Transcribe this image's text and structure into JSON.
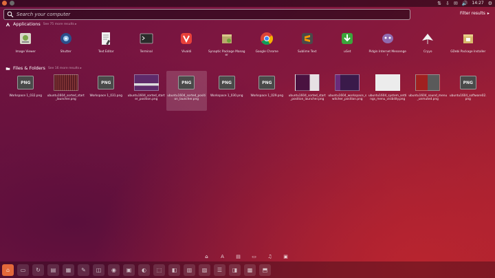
{
  "top_panel": {
    "indicators": [
      "⇅",
      "⇩",
      "✉",
      "🔊",
      "⚙"
    ],
    "time": "14:27"
  },
  "search": {
    "placeholder": "Search your computer"
  },
  "filter": {
    "label": "Filter results",
    "arrow": "▸"
  },
  "applications": {
    "title": "Applications",
    "see_more": "See 75 more results ▸",
    "items": [
      {
        "label": "Image Viewer",
        "icon": "image-viewer-icon"
      },
      {
        "label": "Shutter",
        "icon": "shutter-icon"
      },
      {
        "label": "Text Editor",
        "icon": "text-editor-icon"
      },
      {
        "label": "Terminal",
        "icon": "terminal-icon"
      },
      {
        "label": "Vivaldi",
        "icon": "vivaldi-icon"
      },
      {
        "label": "Synaptic Package Manager",
        "icon": "synaptic-icon"
      },
      {
        "label": "Google Chrome",
        "icon": "chrome-icon"
      },
      {
        "label": "Sublime Text",
        "icon": "sublime-icon"
      },
      {
        "label": "uGet",
        "icon": "uget-icon"
      },
      {
        "label": "Pidgin Internet Messenger",
        "icon": "pidgin-icon"
      },
      {
        "label": "Cryyo",
        "icon": "cryyo-icon"
      },
      {
        "label": "GDebi Package Installer",
        "icon": "gdebi-icon"
      }
    ]
  },
  "files": {
    "title": "Files & Folders",
    "see_more": "See 16 more results ▸",
    "items": [
      {
        "label": "Workspace 1_032.png",
        "thumb": "png"
      },
      {
        "label": "ubuntu1604_sorted_start_launcher.png",
        "thumb": "shot-keyboard"
      },
      {
        "label": "Workspace 1_031.png",
        "thumb": "png"
      },
      {
        "label": "ubuntu1604_sorted_starter_position.png",
        "thumb": "shot-purple"
      },
      {
        "label": "ubuntu1604_sorted_position_launcher.png",
        "thumb": "png",
        "highlight": true
      },
      {
        "label": "Workspace 1_030.png",
        "thumb": "png"
      },
      {
        "label": "Workspace 1_029.png",
        "thumb": "png"
      },
      {
        "label": "ubuntu1604_sorted_start_position_launcher.png",
        "thumb": "shot-dark"
      },
      {
        "label": "ubuntu1604_workspace_switcher_position.png",
        "thumb": "shot-violet"
      },
      {
        "label": "ubuntu1604_system_settings_menu_visibility.png",
        "thumb": "shot-light"
      },
      {
        "label": "ubuntu1604_sound_menu_unmuted.png",
        "thumb": "shot-red"
      },
      {
        "label": "ubuntu1604_software02.png",
        "thumb": "png"
      }
    ]
  },
  "png_label": "PNG",
  "lenses": [
    {
      "name": "home",
      "glyph": "⌂"
    },
    {
      "name": "applications",
      "glyph": "A"
    },
    {
      "name": "files",
      "glyph": "▤"
    },
    {
      "name": "video",
      "glyph": "▭"
    },
    {
      "name": "music",
      "glyph": "♫"
    },
    {
      "name": "photos",
      "glyph": "▣"
    }
  ],
  "launcher": [
    "⌂",
    "▭",
    "↻",
    "▤",
    "▦",
    "✎",
    "◫",
    "◉",
    "▣",
    "◐",
    "⬚",
    "◧",
    "▥",
    "▨",
    "☰",
    "◨",
    "▩",
    "⬒"
  ]
}
